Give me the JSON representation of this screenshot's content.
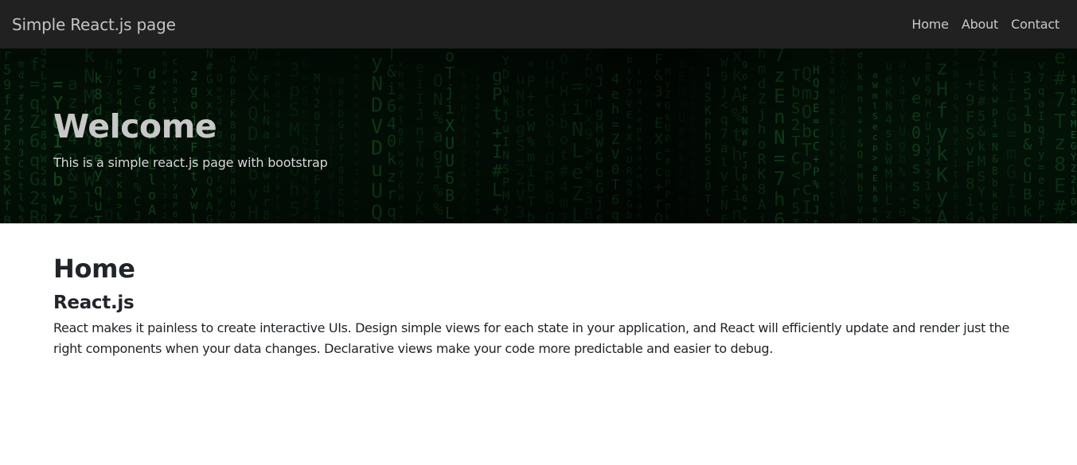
{
  "navbar": {
    "brand": "Simple React.js page",
    "links": [
      {
        "label": "Home"
      },
      {
        "label": "About"
      },
      {
        "label": "Contact"
      }
    ]
  },
  "hero": {
    "title": "Welcome",
    "subtitle": "This is a simple react.js page with bootstrap"
  },
  "main": {
    "title": "Home",
    "section": {
      "title": "React.js",
      "body": "React makes it painless to create interactive UIs. Design simple views for each state in your application, and React will efficiently update and render just the right components when your data changes. Declarative views make your code more predictable and easier to debug."
    }
  },
  "colors": {
    "navbar_bg": "#212121",
    "hero_bg": "#020603",
    "matrix_green": "#1f7a34",
    "text_dark": "#212529"
  }
}
